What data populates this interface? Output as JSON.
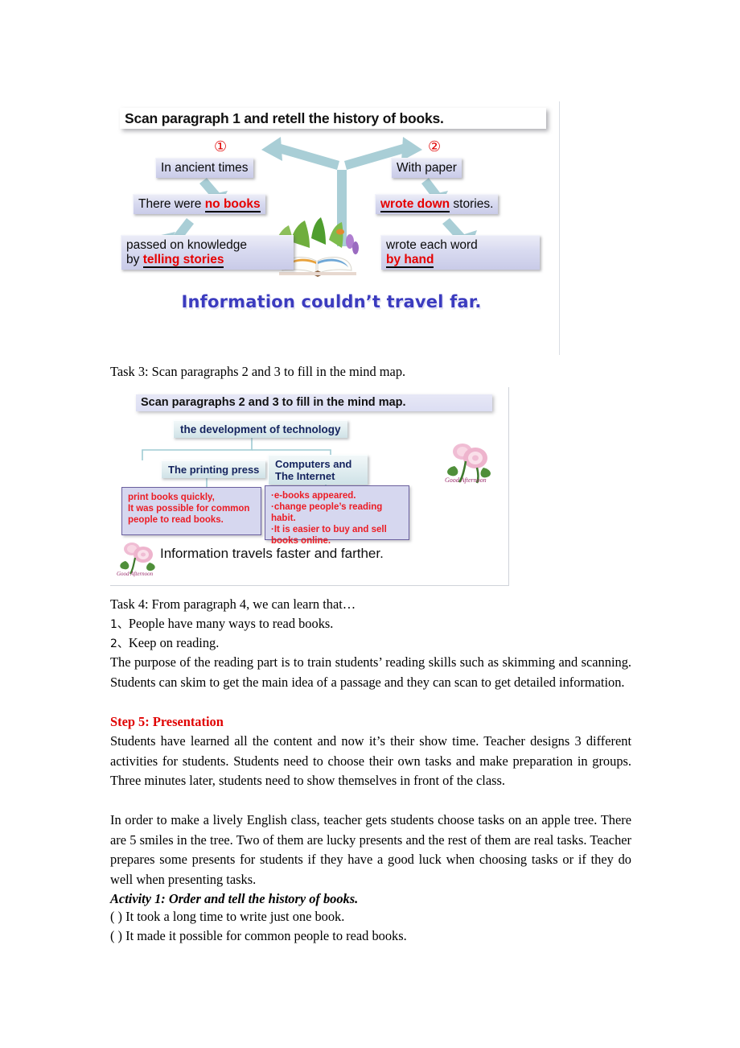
{
  "slide1": {
    "title": "Scan paragraph 1 and retell the history of books.",
    "marker_1": "①",
    "marker_2": "②",
    "boxes": {
      "ancient": "In ancient times",
      "no_books_prefix": "There were ",
      "no_books_key": "no books",
      "passed_prefix": "passed on knowledge",
      "passed_by": "by ",
      "passed_key": "telling stories",
      "with_paper": "With paper",
      "wrote_down_key": "wrote down",
      "wrote_down_rest": " stories.",
      "by_hand_prefix": "wrote each word",
      "by_hand_key": "by hand"
    },
    "footer": "Information couldn’t travel far."
  },
  "task3_line": "Task 3: Scan paragraphs 2 and 3 to fill in the mind map.",
  "slide2": {
    "title": "Scan paragraphs 2 and 3 to fill in the mind map.",
    "root": "the development of technology",
    "branch_left": "The printing press",
    "branch_right": "Computers and\nThe Internet",
    "branch_right_l1": "Computers and",
    "branch_right_l2": "The Internet",
    "detail_left_l1": "print books quickly,",
    "detail_left_l2": "It was possible for common",
    "detail_left_l3": "people to read books.",
    "detail_right_l1": "·e-books appeared.",
    "detail_right_l2": "·change people’s reading",
    "detail_right_l3": "habit.",
    "detail_right_l4": "·It is easier to buy and sell",
    "detail_right_l5": "books online.",
    "footer": "Information travels faster and farther.",
    "rose_caption": "Good Afternoon"
  },
  "body": {
    "task4_heading": "Task 4: From paragraph 4, we can learn that…",
    "item1_num": "1、",
    "item1_text": "People have many ways to read books.",
    "item2_num": "2、",
    "item2_text": "Keep on reading.",
    "purpose_para": "The purpose of the reading part is to train students’ reading skills such as skimming and scanning. Students can skim to get the main idea of a passage and they can scan to get detailed information.",
    "step5_heading": "Step 5: Presentation",
    "step5_para1": "Students have learned all the content and now it’s their show time. Teacher designs 3 different activities for students. Students need to choose their own tasks and make preparation in groups. Three minutes later, students need to show themselves in front of the class.",
    "step5_para2": "In order to make a lively English class, teacher gets students choose tasks on an apple tree. There are 5 smiles in the tree. Two of them are lucky presents and the rest of them are real tasks. Teacher prepares some presents for students if they have a good luck when choosing tasks or if they do well when presenting tasks.",
    "activity1_heading": "Activity 1: Order and tell the history of books.",
    "activity1_item1": "(        ) It took a long time to write just one book.",
    "activity1_item2": "(        ) It made it possible for common people to read books."
  },
  "colors": {
    "red": "#e60000",
    "indigo": "#3b3bbf",
    "navy": "#14235e",
    "lavender_box": "#d8daf0",
    "teal_arrow": "#a8cfd6",
    "purple_border": "#6a5f9e"
  }
}
